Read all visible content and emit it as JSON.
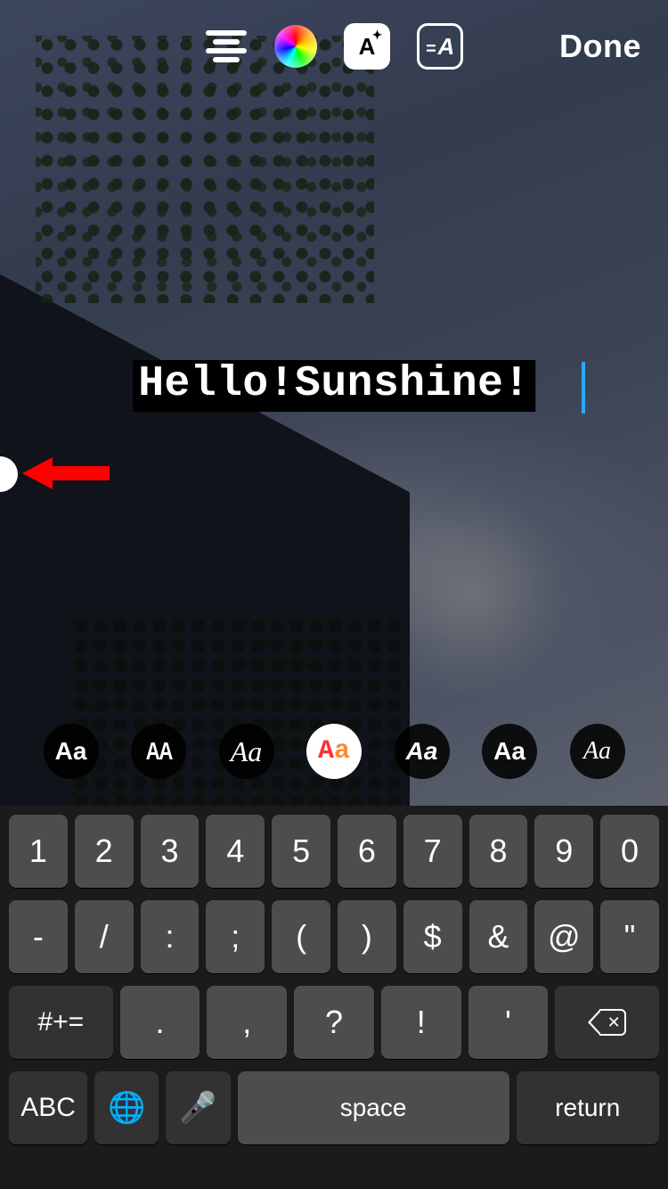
{
  "toolbar": {
    "done_label": "Done",
    "effects_label": "A",
    "animated_label": "A",
    "animated_prefix": "="
  },
  "story": {
    "text": "Hello!Sunshine!"
  },
  "fonts": {
    "options": [
      {
        "label": "Aa"
      },
      {
        "label": "AA"
      },
      {
        "label": "Aa"
      },
      {
        "label": "Aa"
      },
      {
        "label": "Aa"
      },
      {
        "label": "Aa"
      },
      {
        "label": "Aa"
      }
    ]
  },
  "keyboard": {
    "row1": [
      "1",
      "2",
      "3",
      "4",
      "5",
      "6",
      "7",
      "8",
      "9",
      "0"
    ],
    "row2": [
      "-",
      "/",
      ":",
      ";",
      "(",
      ")",
      "$",
      "&",
      "@",
      "\""
    ],
    "row3": {
      "shift": "#+=",
      "keys": [
        ".",
        ",",
        "?",
        "!",
        "'"
      ]
    },
    "row4": {
      "abc": "ABC",
      "space": "space",
      "return": "return"
    }
  }
}
